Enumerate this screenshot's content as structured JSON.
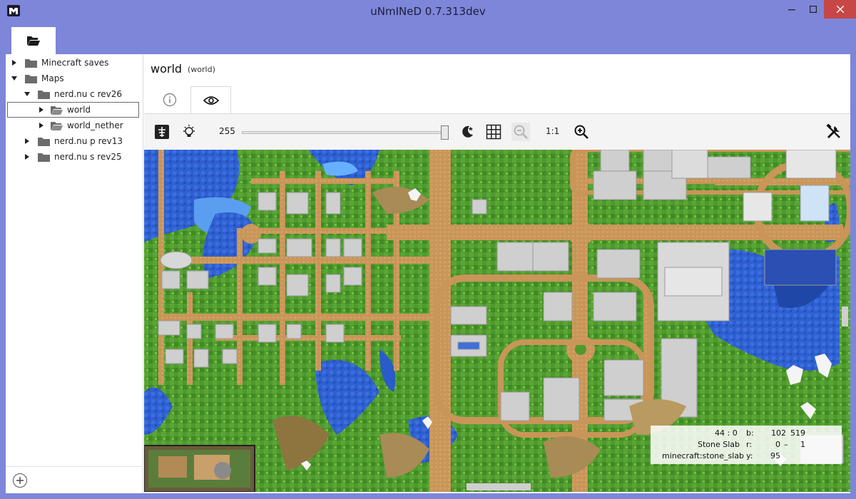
{
  "window": {
    "title": "uNmINeD 0.7.313dev",
    "logo_icon": "unmined-logo-icon",
    "accent": "#7d86d9"
  },
  "ribbon": {
    "tab_icon": "folder-open-icon"
  },
  "tree": {
    "items": [
      {
        "label": "Minecraft saves",
        "level": 0
      },
      {
        "label": "Maps",
        "level": 0
      },
      {
        "label": "nerd.nu c rev26",
        "level": 1
      },
      {
        "label": "world",
        "level": 2,
        "selected": true
      },
      {
        "label": "world_nether",
        "level": 2
      },
      {
        "label": "nerd.nu p rev13",
        "level": 1
      },
      {
        "label": "nerd.nu s rev25",
        "level": 1
      }
    ],
    "add_icon": "add-circle-icon"
  },
  "header": {
    "title": "world",
    "subtitle": "(world)"
  },
  "tabs": [
    {
      "icon": "info-icon"
    },
    {
      "icon": "eye-icon",
      "active": true
    }
  ],
  "toolbar": {
    "height_value": "255",
    "slider_fraction": 1.0,
    "zoom_label": "1:1",
    "icons": [
      "topography-icon",
      "light-bulb-icon",
      "night-mode-icon",
      "grid-icon",
      "zoom-out-icon",
      "zoom-in-icon",
      "tools-icon"
    ]
  },
  "info": {
    "coords": "44 : 0",
    "b_label": "b:",
    "b_x": "102",
    "b_z": "519",
    "block_name": "Stone Slab",
    "r_label": "r:",
    "r_x": "0",
    "r_dash": "–",
    "r_z": "1",
    "block_id": "minecraft:stone_slab",
    "y_label": "y:",
    "y_value": "95"
  }
}
